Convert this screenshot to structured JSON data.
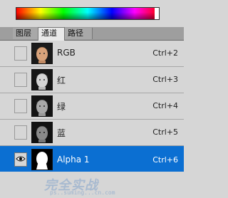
{
  "tabs": [
    {
      "label": "图层",
      "active": false
    },
    {
      "label": "通道",
      "active": true
    },
    {
      "label": "路径",
      "active": false
    }
  ],
  "channels": [
    {
      "name": "RGB",
      "shortcut": "Ctrl+2",
      "visible": false,
      "selected": false,
      "thumbnail": "face-color"
    },
    {
      "name": "红",
      "shortcut": "Ctrl+3",
      "visible": false,
      "selected": false,
      "thumbnail": "face-gray"
    },
    {
      "name": "绿",
      "shortcut": "Ctrl+4",
      "visible": false,
      "selected": false,
      "thumbnail": "face-gray"
    },
    {
      "name": "蓝",
      "shortcut": "Ctrl+5",
      "visible": false,
      "selected": false,
      "thumbnail": "face-gray-dark"
    },
    {
      "name": "Alpha 1",
      "shortcut": "Ctrl+6",
      "visible": true,
      "selected": true,
      "thumbnail": "silhouette-mask"
    }
  ],
  "watermark": {
    "text": "完全实战",
    "sub": "ps..suming...cn.com"
  },
  "colors": {
    "selection": "#0b6fd2",
    "panel": "#d6d6d6"
  }
}
